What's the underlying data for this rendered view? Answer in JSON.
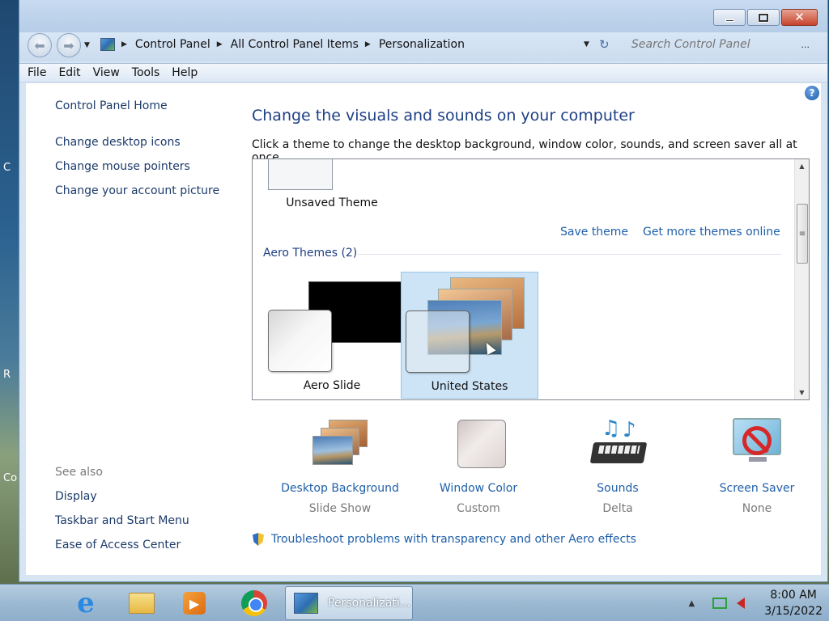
{
  "desktop": {
    "labels": [
      "C",
      "R",
      "Co"
    ]
  },
  "window": {
    "caption_buttons": {
      "minimize": "minimize",
      "maximize": "maximize",
      "close": "✕"
    }
  },
  "address": {
    "crumbs": [
      "Control Panel",
      "All Control Panel Items",
      "Personalization"
    ],
    "search_placeholder": "Search Control Panel",
    "search_more": "..."
  },
  "menu": [
    "File",
    "Edit",
    "View",
    "Tools",
    "Help"
  ],
  "left_pane": {
    "home": "Control Panel Home",
    "links": [
      "Change desktop icons",
      "Change mouse pointers",
      "Change your account picture"
    ],
    "see_also_label": "See also",
    "see_also": [
      "Display",
      "Taskbar and Start Menu",
      "Ease of Access Center"
    ]
  },
  "main": {
    "title": "Change the visuals and sounds on your computer",
    "description": "Click a theme to change the desktop background, window color, sounds, and screen saver all at once.",
    "unsaved_theme": "Unsaved Theme",
    "save_theme": "Save theme",
    "get_more": "Get more themes online",
    "group_header": "Aero Themes (2)",
    "themes": [
      {
        "name": "Aero Slide",
        "selected": false
      },
      {
        "name": "United States",
        "selected": true
      }
    ],
    "settings": [
      {
        "label": "Desktop Background",
        "value": "Slide Show",
        "icon": "desktop-background-icon"
      },
      {
        "label": "Window Color",
        "value": "Custom",
        "icon": "window-color-icon"
      },
      {
        "label": "Sounds",
        "value": "Delta",
        "icon": "sounds-icon"
      },
      {
        "label": "Screen Saver",
        "value": "None",
        "icon": "screen-saver-icon"
      }
    ],
    "troubleshoot": "Troubleshoot problems with transparency and other Aero effects"
  },
  "taskbar": {
    "active_task": "Personalizati...",
    "time": "8:00 AM",
    "date": "3/15/2022"
  },
  "colors": {
    "link": "#1f5fa8",
    "heading": "#1e3f84",
    "selected_tile": "#cde4f7"
  }
}
